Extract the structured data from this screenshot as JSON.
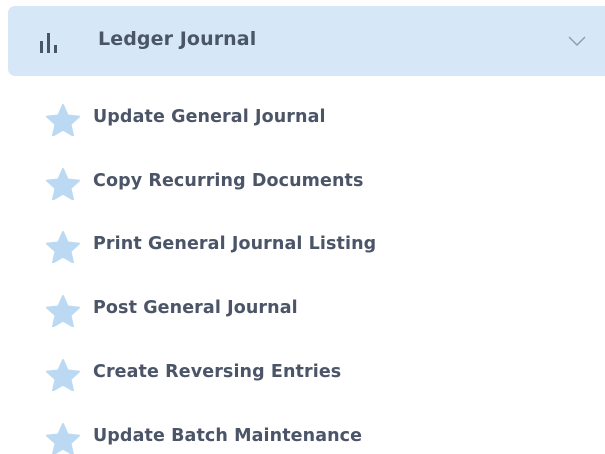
{
  "menu": {
    "header": {
      "label": "Ledger Journal",
      "icon": "bar-chart-icon",
      "chevron_icon": "chevron-down-icon",
      "background_color": "#d6e8f8"
    },
    "items": [
      {
        "label": "Update General Journal",
        "icon": "star-icon"
      },
      {
        "label": "Copy Recurring Documents",
        "icon": "star-icon"
      },
      {
        "label": "Print General Journal Listing",
        "icon": "star-icon"
      },
      {
        "label": "Post General Journal",
        "icon": "star-icon"
      },
      {
        "label": "Create Reversing Entries",
        "icon": "star-icon"
      },
      {
        "label": "Update Batch Maintenance",
        "icon": "star-icon"
      }
    ],
    "star_color": "#bcd9f3",
    "text_color": "#4b5567"
  }
}
